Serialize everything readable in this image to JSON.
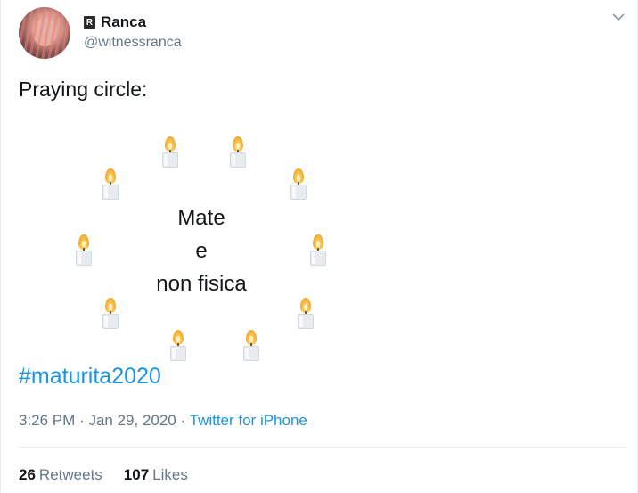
{
  "user": {
    "badge_letter": "R",
    "display_name": "Ranca",
    "handle": "@witnessranca"
  },
  "tweet": {
    "text": "Praying circle:",
    "circle_lines": [
      "Mate",
      "e",
      "non fisica"
    ],
    "hashtag": "#maturita2020",
    "time": "3:26 PM",
    "separator": "·",
    "date": "Jan 29, 2020",
    "source": "Twitter for iPhone"
  },
  "stats": {
    "retweets_count": "26",
    "retweets_label": "Retweets",
    "likes_count": "107",
    "likes_label": "Likes"
  },
  "icons": {
    "candle": "candle-icon",
    "caret": "chevron-down-icon"
  },
  "colors": {
    "link": "#1b95e0",
    "secondary_text": "#657786",
    "primary_text": "#14171a"
  }
}
